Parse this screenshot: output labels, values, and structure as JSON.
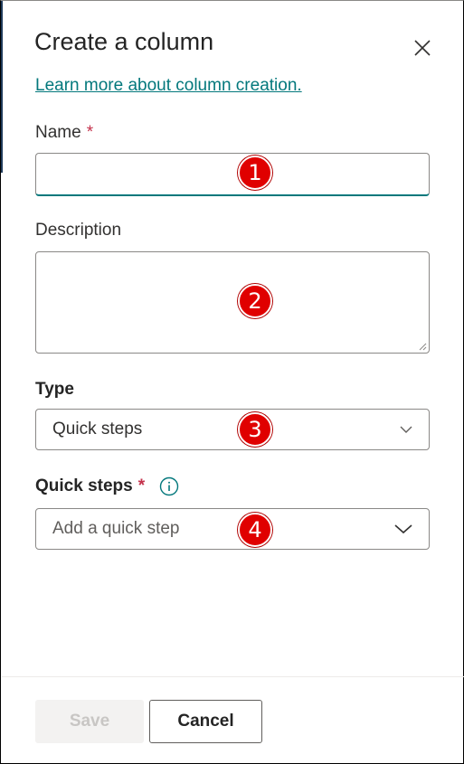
{
  "panel": {
    "title": "Create a column",
    "learn_more_link": "Learn more about column creation."
  },
  "fields": {
    "name": {
      "label": "Name",
      "required_mark": "*",
      "value": ""
    },
    "description": {
      "label": "Description",
      "value": ""
    },
    "type": {
      "label": "Type",
      "selected": "Quick steps"
    },
    "quick_steps": {
      "label": "Quick steps",
      "required_mark": "*",
      "placeholder": "Add a quick step"
    }
  },
  "annotations": [
    "1",
    "2",
    "3",
    "4"
  ],
  "footer": {
    "save_label": "Save",
    "cancel_label": "Cancel"
  },
  "colors": {
    "accent": "#03787c",
    "required": "#c4314b",
    "annotation_badge": "#e00000"
  },
  "icons": {
    "close": "close-icon",
    "chevron": "chevron-down-icon",
    "info": "info-icon"
  }
}
